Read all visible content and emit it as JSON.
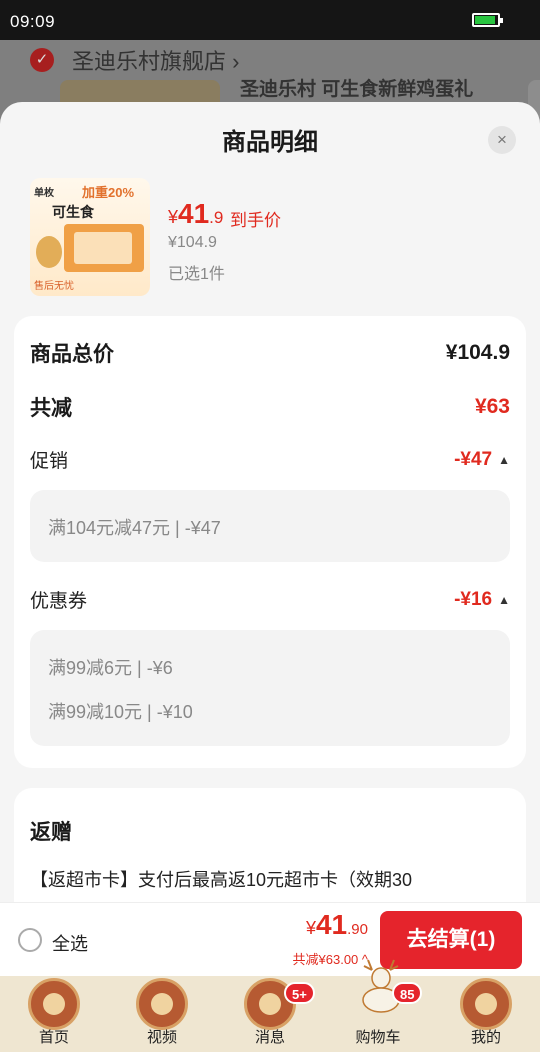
{
  "status_bar": {
    "time": "09:09",
    "battery_level": 0.9
  },
  "background": {
    "store_name": "圣迪乐村旗舰店",
    "store_chevron": "›",
    "product_title": "圣迪乐村 可生食新鲜鸡蛋礼"
  },
  "sheet": {
    "title": "商品明细",
    "close_icon": "×",
    "product": {
      "image_tag_left": "单枚",
      "image_tag_right": "加重20%",
      "image_name": "可生食",
      "image_badge": "售后无忧",
      "price_symbol": "¥",
      "price_int": "41",
      "price_dec": ".9",
      "price_tag": "到手价",
      "original_price": "¥104.9",
      "selected_count": "已选1件"
    },
    "breakdown": {
      "total_label": "商品总价",
      "total_value": "¥104.9",
      "discount_label": "共减",
      "discount_value": "¥63",
      "promotion": {
        "label": "促销",
        "value": "-¥47",
        "items": [
          "满104元减47元 | -¥47"
        ]
      },
      "coupon": {
        "label": "优惠券",
        "value": "-¥16",
        "items": [
          "满99减6元 | -¥6",
          "满99减10元 | -¥10"
        ]
      }
    },
    "gift": {
      "title": "返赠",
      "description": "【返超市卡】支付后最高返10元超市卡（效期30"
    }
  },
  "footer": {
    "select_all": "全选",
    "total_symbol": "¥",
    "total_int": "41",
    "total_dec": ".90",
    "total_saved": "共减¥63.00 ^",
    "checkout_label": "去结算(1)"
  },
  "tabbar": {
    "tabs": [
      {
        "label": "首页",
        "icon": "home-icon",
        "badge": ""
      },
      {
        "label": "视频",
        "icon": "video-icon",
        "badge": ""
      },
      {
        "label": "消息",
        "icon": "message-icon",
        "badge": "5+"
      },
      {
        "label": "购物车",
        "icon": "cart-icon",
        "badge": "85"
      },
      {
        "label": "我的",
        "icon": "profile-icon",
        "badge": ""
      }
    ]
  },
  "colors": {
    "accent_red": "#e02a1f",
    "checkout_red": "#e5242c",
    "tabbar_bg": "#efe6d1"
  }
}
